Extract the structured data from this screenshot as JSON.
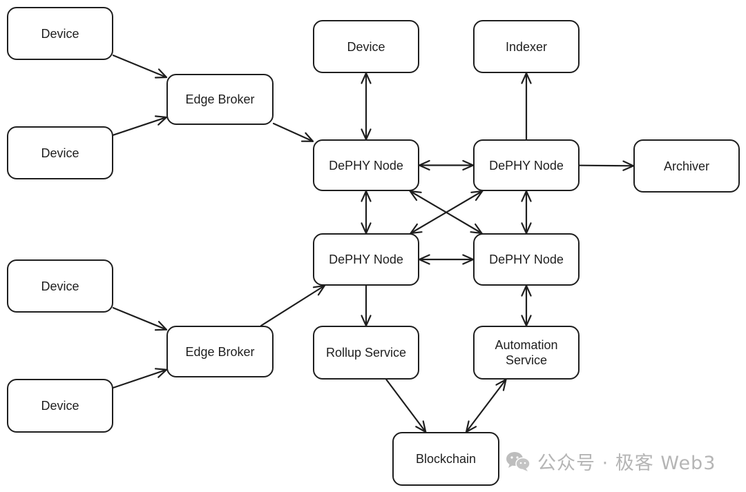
{
  "diagram": {
    "nodes": [
      {
        "id": "device-1",
        "label": "Device"
      },
      {
        "id": "device-2",
        "label": "Device"
      },
      {
        "id": "edge-broker-1",
        "label": "Edge Broker"
      },
      {
        "id": "device-top",
        "label": "Device"
      },
      {
        "id": "indexer",
        "label": "Indexer"
      },
      {
        "id": "dephy-node-a",
        "label": "DePHY Node"
      },
      {
        "id": "dephy-node-b",
        "label": "DePHY Node"
      },
      {
        "id": "archiver",
        "label": "Archiver"
      },
      {
        "id": "dephy-node-c",
        "label": "DePHY Node"
      },
      {
        "id": "dephy-node-d",
        "label": "DePHY Node"
      },
      {
        "id": "device-3",
        "label": "Device"
      },
      {
        "id": "device-4",
        "label": "Device"
      },
      {
        "id": "edge-broker-2",
        "label": "Edge Broker"
      },
      {
        "id": "rollup-service",
        "label": "Rollup Service"
      },
      {
        "id": "automation-service",
        "label": "Automation\nService"
      },
      {
        "id": "blockchain",
        "label": "Blockchain"
      }
    ],
    "edges": [
      {
        "from": "device-1",
        "to": "edge-broker-1",
        "direction": "forward"
      },
      {
        "from": "device-2",
        "to": "edge-broker-1",
        "direction": "forward"
      },
      {
        "from": "edge-broker-1",
        "to": "dephy-node-a",
        "direction": "forward"
      },
      {
        "from": "device-top",
        "to": "dephy-node-a",
        "direction": "both"
      },
      {
        "from": "dephy-node-b",
        "to": "indexer",
        "direction": "forward"
      },
      {
        "from": "dephy-node-a",
        "to": "dephy-node-b",
        "direction": "both"
      },
      {
        "from": "dephy-node-b",
        "to": "archiver",
        "direction": "forward"
      },
      {
        "from": "dephy-node-a",
        "to": "dephy-node-c",
        "direction": "both"
      },
      {
        "from": "dephy-node-b",
        "to": "dephy-node-d",
        "direction": "both"
      },
      {
        "from": "dephy-node-a",
        "to": "dephy-node-d",
        "direction": "both"
      },
      {
        "from": "dephy-node-b",
        "to": "dephy-node-c",
        "direction": "both"
      },
      {
        "from": "dephy-node-c",
        "to": "dephy-node-d",
        "direction": "both"
      },
      {
        "from": "device-3",
        "to": "edge-broker-2",
        "direction": "forward"
      },
      {
        "from": "device-4",
        "to": "edge-broker-2",
        "direction": "forward"
      },
      {
        "from": "edge-broker-2",
        "to": "dephy-node-c",
        "direction": "forward"
      },
      {
        "from": "dephy-node-c",
        "to": "rollup-service",
        "direction": "forward"
      },
      {
        "from": "dephy-node-d",
        "to": "automation-service",
        "direction": "both"
      },
      {
        "from": "rollup-service",
        "to": "blockchain",
        "direction": "forward"
      },
      {
        "from": "automation-service",
        "to": "blockchain",
        "direction": "both"
      }
    ],
    "stroke_color": "#1e1e1e"
  },
  "watermark": {
    "icon": "wechat-icon",
    "text": "公众号 · 极客 Web3",
    "color": "#b5b5b5"
  }
}
